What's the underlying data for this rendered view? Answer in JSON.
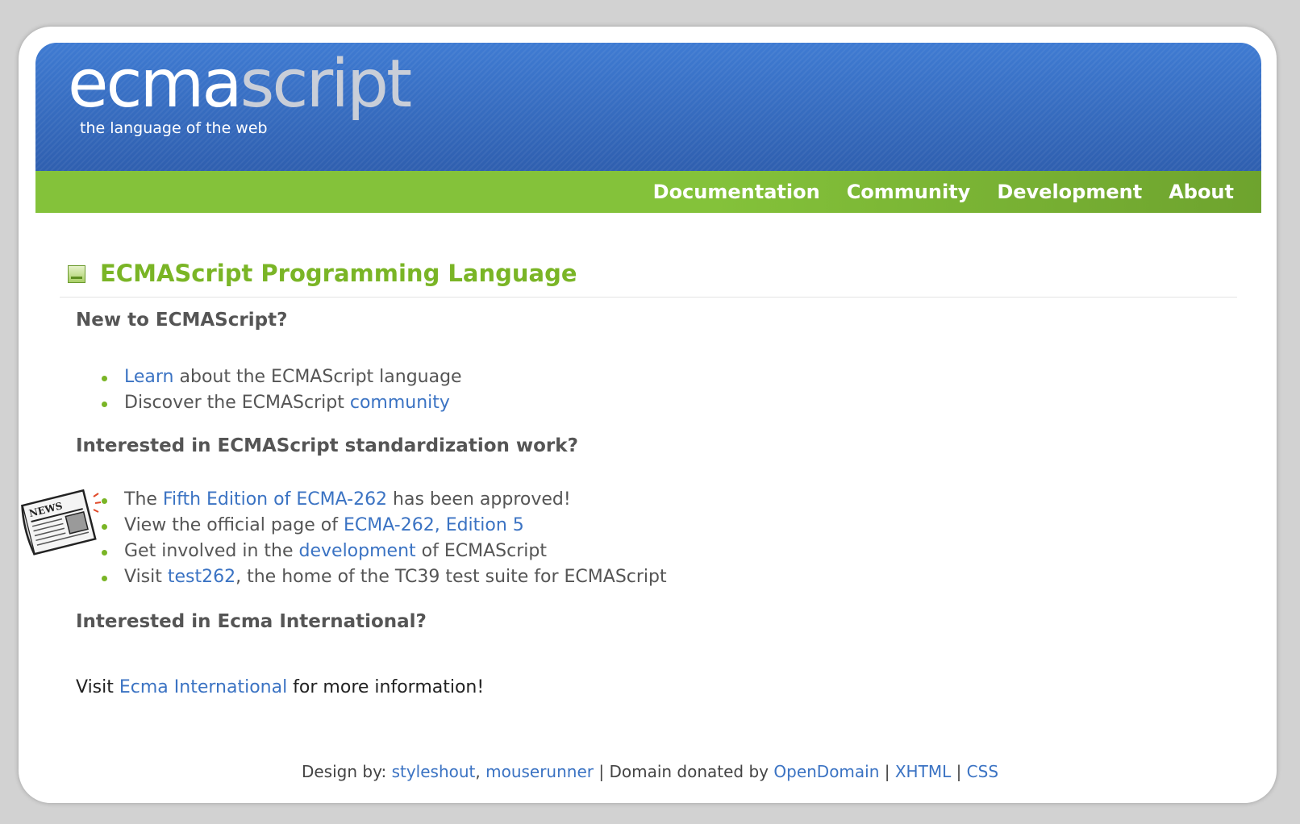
{
  "header": {
    "logo_part1": "ecma",
    "logo_part2": "script",
    "tagline": "the language of the web"
  },
  "nav": {
    "items": [
      {
        "label": "Documentation"
      },
      {
        "label": "Community"
      },
      {
        "label": "Development"
      },
      {
        "label": "About"
      }
    ]
  },
  "main": {
    "title": "ECMAScript Programming Language",
    "sections": [
      {
        "heading": "New to ECMAScript?",
        "items": [
          {
            "before": "",
            "link": "Learn",
            "after": " about the ECMAScript language"
          },
          {
            "before": "Discover the ECMAScript ",
            "link": "community",
            "after": ""
          }
        ]
      },
      {
        "heading": "Interested in ECMAScript standardization work?",
        "items": [
          {
            "before": "The ",
            "link": "Fifth Edition of ECMA-262",
            "after": " has been approved!"
          },
          {
            "before": "View the official page of ",
            "link": "ECMA-262, Edition 5",
            "after": ""
          },
          {
            "before": "Get involved in the ",
            "link": "development",
            "after": " of ECMAScript"
          },
          {
            "before": "Visit ",
            "link": "test262",
            "after": ", the home of the TC39 test suite for ECMAScript"
          }
        ]
      },
      {
        "heading": "Interested in Ecma International?",
        "visit": {
          "before": "Visit ",
          "link": "Ecma International",
          "after": " for more information!"
        }
      }
    ],
    "news_icon_text": "NEWS"
  },
  "footer": {
    "design_by": "Design by: ",
    "link1": "styleshout",
    "sep1": ", ",
    "link2": "mouserunner",
    "domain_text": " | Domain donated by ",
    "link3": "OpenDomain",
    "sep2": " | ",
    "link4": "XHTML",
    "sep3": " | ",
    "link5": "CSS"
  },
  "colors": {
    "header_blue": "#3a72c8",
    "nav_green": "#84c23a",
    "title_green": "#7ab526",
    "link_blue": "#3b73c3",
    "bullet_green": "#7ab526"
  }
}
